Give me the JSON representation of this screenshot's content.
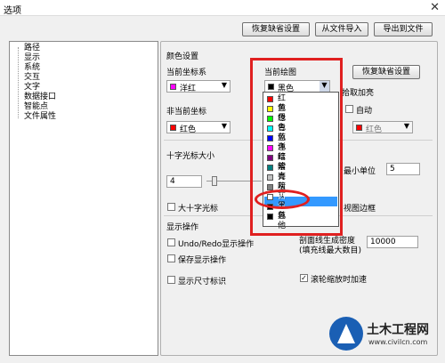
{
  "window": {
    "title": "选项",
    "close_glyph": "✕"
  },
  "top_buttons": {
    "restore_defaults": "恢复缺省设置",
    "import": "从文件导入",
    "export": "导出到文件"
  },
  "tree": {
    "items": [
      "路径",
      "显示",
      "系统",
      "交互",
      "文字",
      "数据接口",
      "智能点",
      "文件属性"
    ]
  },
  "color_group": {
    "title": "颜色设置",
    "current_axis_label": "当前坐标系",
    "current_axis_value": "洋红",
    "current_axis_color": "#ff00ff",
    "current_drawing_label": "当前绘图",
    "current_drawing_value": "黑色",
    "current_drawing_color": "#000000",
    "restore_defaults": "恢复缺省设置",
    "noncurrent_axis_label": "非当前坐标",
    "noncurrent_axis_value": "红色",
    "noncurrent_axis_color": "#ff0000",
    "pickup_highlight_label": "拾取加亮",
    "auto_label": "自动",
    "pickup_value": "红色",
    "pickup_color": "#ff0000"
  },
  "dropdown": {
    "options": [
      {
        "label": "红色",
        "color": "#ff0000"
      },
      {
        "label": "黄色",
        "color": "#ffff00"
      },
      {
        "label": "绿色",
        "color": "#00ff00"
      },
      {
        "label": "青色",
        "color": "#00ffff"
      },
      {
        "label": "蓝色",
        "color": "#0000ff"
      },
      {
        "label": "洋红",
        "color": "#ff00ff"
      },
      {
        "label": "暗紫",
        "color": "#800080"
      },
      {
        "label": "暗青",
        "color": "#008080"
      },
      {
        "label": "亮灰",
        "color": "#c0c0c0"
      },
      {
        "label": "暗灰",
        "color": "#808080"
      },
      {
        "label": "白色",
        "color": "#ffffff"
      },
      {
        "label": "黑色",
        "color": "#000000"
      },
      {
        "label": "其他",
        "color": "#000000"
      }
    ],
    "highlighted_option": "白色"
  },
  "cursor_group": {
    "title": "十字光标大小",
    "size_value": "4",
    "big_cursor_label": "大十字光标",
    "min_unit_label": "最小单位",
    "min_unit_value": "5",
    "viewport_border_label": "视图边框"
  },
  "display_ops": {
    "title": "显示操作",
    "undo_redo_label": "Undo/Redo显示操作",
    "save_display_label": "保存显示操作",
    "fill_density_label": "剖面线生成密度",
    "fill_density_sub": "(填充线最大数目)",
    "fill_density_value": "10000"
  },
  "bottom": {
    "show_dim_label": "显示尺寸标识",
    "wheel_zoom_label": "滚轮缩放时加速"
  },
  "watermark": {
    "name": "土木工程网",
    "url": "www.civilcn.com"
  }
}
